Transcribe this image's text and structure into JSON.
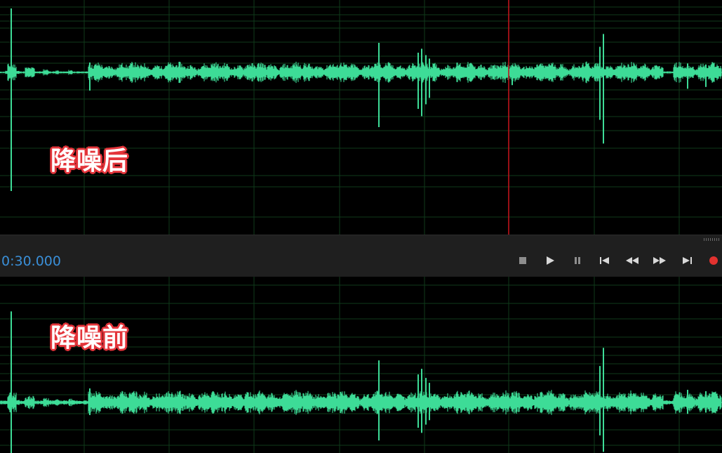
{
  "colors": {
    "waveform": "#3ddc97",
    "grid": "#0f3a1a",
    "playhead": "#c0141c",
    "timecode": "#3a8fd8",
    "record": "#e2322f",
    "annotation_outline": "#e4343a"
  },
  "top_panel": {
    "label": "降噪后"
  },
  "bottom_panel": {
    "label": "降噪前"
  },
  "transport": {
    "timecode": "0:30.000",
    "buttons": [
      {
        "name": "stop-button",
        "icon": "stop-icon"
      },
      {
        "name": "play-button",
        "icon": "play-icon"
      },
      {
        "name": "pause-button",
        "icon": "pause-icon"
      },
      {
        "name": "move-to-previous-button",
        "icon": "skip-previous-icon"
      },
      {
        "name": "rewind-button",
        "icon": "rewind-icon"
      },
      {
        "name": "fast-forward-button",
        "icon": "fast-forward-icon"
      },
      {
        "name": "move-to-next-button",
        "icon": "skip-next-icon"
      },
      {
        "name": "record-button",
        "icon": "record-icon"
      }
    ]
  }
}
